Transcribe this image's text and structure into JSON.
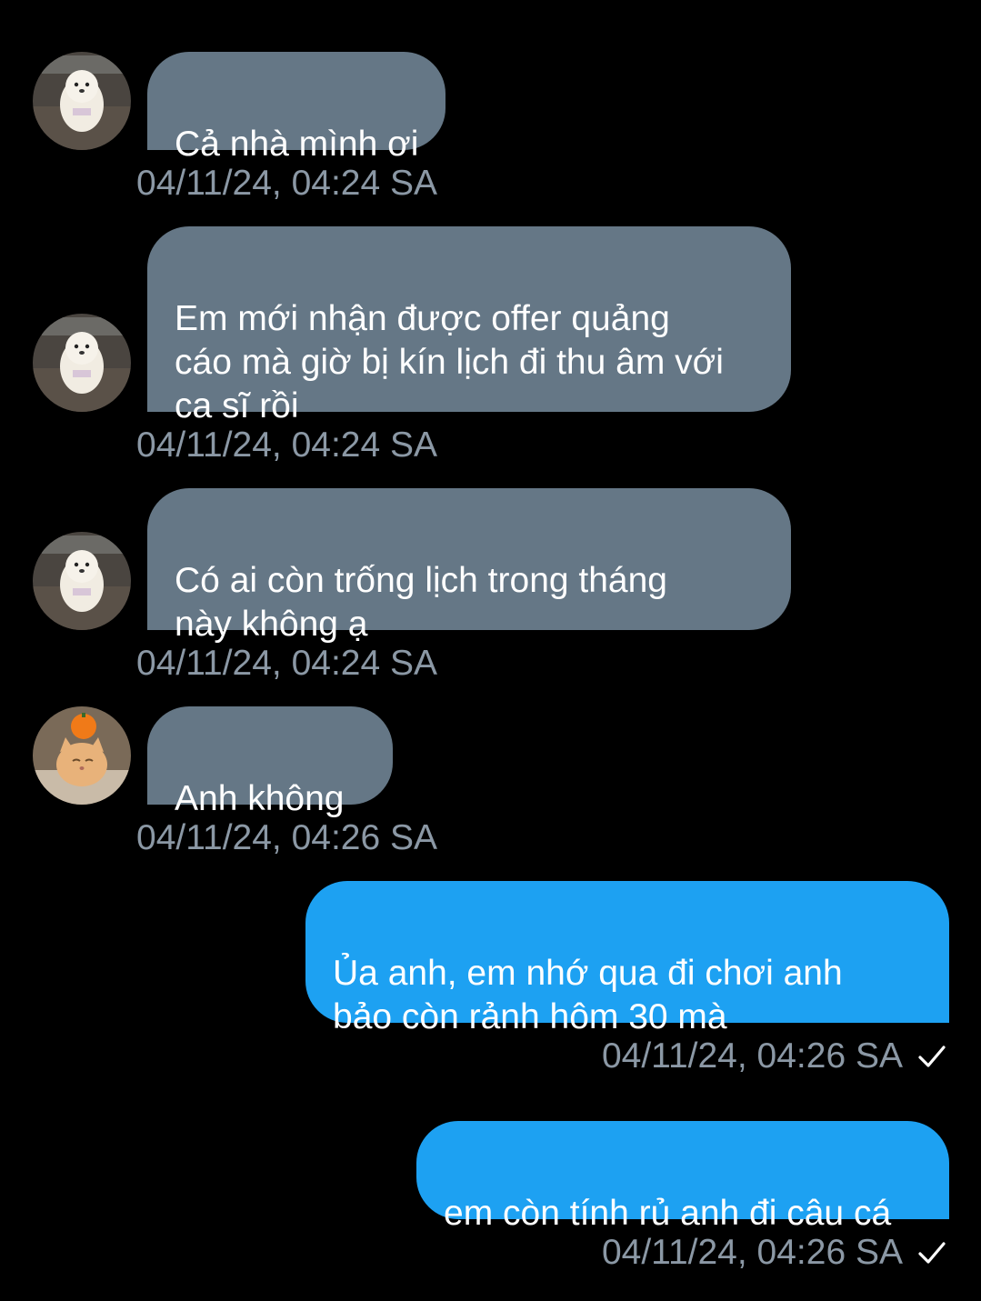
{
  "messages": [
    {
      "direction": "incoming",
      "avatar": "white-pomeranian-dog",
      "text": "Cả nhà mình ơi",
      "timestamp": "04/11/24, 04:24 SA"
    },
    {
      "direction": "incoming",
      "avatar": "white-pomeranian-dog",
      "text": "Em mới nhận được offer quảng\ncáo mà giờ bị kín lịch đi thu âm với\nca sĩ rồi",
      "timestamp": "04/11/24, 04:24 SA"
    },
    {
      "direction": "incoming",
      "avatar": "white-pomeranian-dog",
      "text": "Có ai còn trống lịch trong tháng\nnày không ạ",
      "timestamp": "04/11/24, 04:24 SA"
    },
    {
      "direction": "incoming",
      "avatar": "orange-cat-with-tangerine",
      "text": "Anh không",
      "timestamp": "04/11/24, 04:26 SA"
    },
    {
      "direction": "outgoing",
      "text": "Ủa anh, em nhớ qua đi chơi anh\nbảo còn rảnh hôm 30 mà",
      "timestamp": "04/11/24, 04:26 SA",
      "status_icon": "checkmark-icon"
    },
    {
      "direction": "outgoing",
      "text": "em còn tính rủ anh đi câu cá",
      "timestamp": "04/11/24, 04:26 SA",
      "status_icon": "checkmark-icon"
    }
  ],
  "colors": {
    "background": "#000000",
    "incoming_bubble": "#657786",
    "outgoing_bubble": "#1da1f2",
    "timestamp_text": "#8b98a5",
    "message_text": "#ffffff"
  }
}
